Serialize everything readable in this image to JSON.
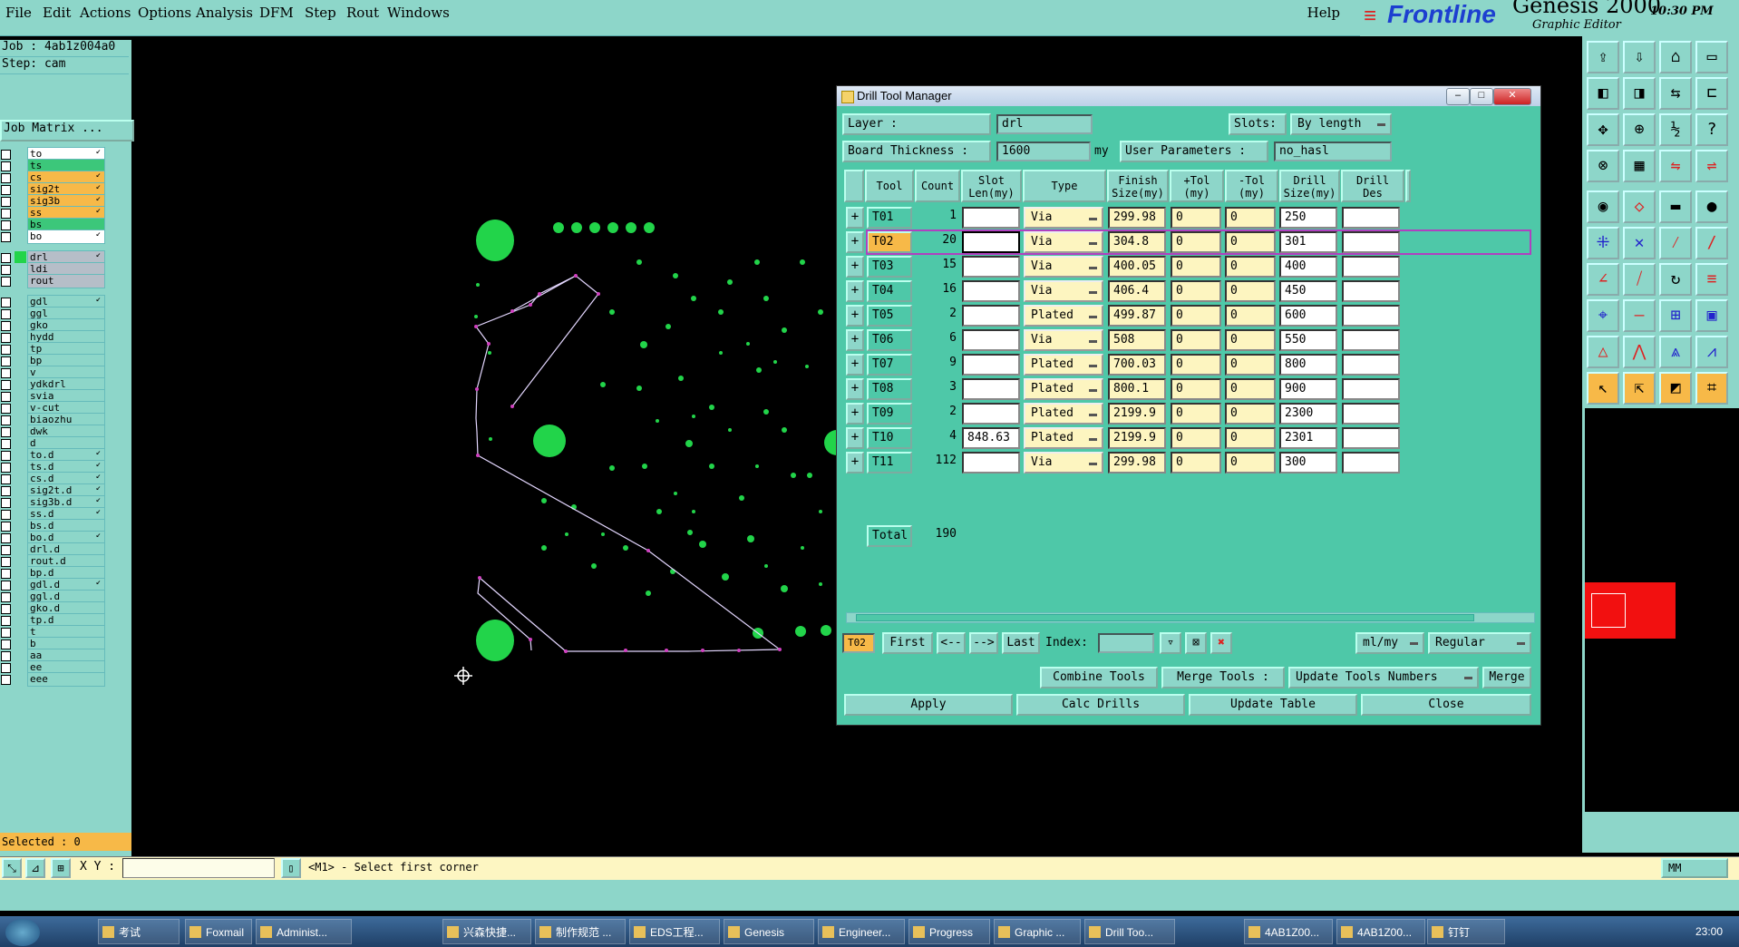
{
  "menubar": {
    "items": [
      "File",
      "Edit",
      "Actions",
      "Options",
      "Analysis",
      "DFM",
      "Step",
      "Rout",
      "Windows"
    ],
    "help": "Help",
    "brand": "Frontline",
    "product": "Genesis 2000",
    "subtitle": "Graphic Editor",
    "clock": "10:30 PM"
  },
  "left": {
    "job": "Job  : 4ab1z004a0",
    "step": "Step: cam",
    "job_matrix": "Job Matrix ...",
    "selected": "Selected : 0",
    "layers": [
      {
        "name": "to",
        "bg": "#ffffff",
        "ind": "",
        "arrow": true
      },
      {
        "name": "ts",
        "bg": "#3cc77a",
        "ind": "",
        "arrow": false
      },
      {
        "name": "cs",
        "bg": "#f7b948",
        "ind": "",
        "arrow": true
      },
      {
        "name": "sig2t",
        "bg": "#f7b948",
        "ind": "",
        "arrow": true
      },
      {
        "name": "sig3b",
        "bg": "#f7b948",
        "ind": "",
        "arrow": true
      },
      {
        "name": "ss",
        "bg": "#f7b948",
        "ind": "",
        "arrow": true
      },
      {
        "name": "bs",
        "bg": "#3cc77a",
        "ind": "",
        "arrow": false
      },
      {
        "name": "bo",
        "bg": "#ffffff",
        "ind": "",
        "arrow": true
      },
      {
        "name": "drl",
        "bg": "#b6bec8",
        "ind": "#22d44a",
        "arrow": true
      },
      {
        "name": "ldi",
        "bg": "#b6bec8",
        "ind": "",
        "arrow": false
      },
      {
        "name": "rout",
        "bg": "#b6bec8",
        "ind": "",
        "arrow": false
      },
      {
        "name": "gdl",
        "bg": "#8dd6c9",
        "ind": "",
        "arrow": true
      },
      {
        "name": "ggl",
        "bg": "#8dd6c9",
        "ind": "",
        "arrow": false
      },
      {
        "name": "gko",
        "bg": "#8dd6c9",
        "ind": "",
        "arrow": false
      },
      {
        "name": "hydd",
        "bg": "#8dd6c9",
        "ind": "",
        "arrow": false
      },
      {
        "name": "tp",
        "bg": "#8dd6c9",
        "ind": "",
        "arrow": false
      },
      {
        "name": "bp",
        "bg": "#8dd6c9",
        "ind": "",
        "arrow": false
      },
      {
        "name": "v",
        "bg": "#8dd6c9",
        "ind": "",
        "arrow": false
      },
      {
        "name": "ydkdrl",
        "bg": "#8dd6c9",
        "ind": "",
        "arrow": false
      },
      {
        "name": "svia",
        "bg": "#8dd6c9",
        "ind": "",
        "arrow": false
      },
      {
        "name": "v-cut",
        "bg": "#8dd6c9",
        "ind": "",
        "arrow": false
      },
      {
        "name": "biaozhu",
        "bg": "#8dd6c9",
        "ind": "",
        "arrow": false
      },
      {
        "name": "dwk",
        "bg": "#8dd6c9",
        "ind": "",
        "arrow": false
      },
      {
        "name": "d",
        "bg": "#8dd6c9",
        "ind": "",
        "arrow": false
      },
      {
        "name": "to.d",
        "bg": "#8dd6c9",
        "ind": "",
        "arrow": true
      },
      {
        "name": "ts.d",
        "bg": "#8dd6c9",
        "ind": "",
        "arrow": true
      },
      {
        "name": "cs.d",
        "bg": "#8dd6c9",
        "ind": "",
        "arrow": true
      },
      {
        "name": "sig2t.d",
        "bg": "#8dd6c9",
        "ind": "",
        "arrow": true
      },
      {
        "name": "sig3b.d",
        "bg": "#8dd6c9",
        "ind": "",
        "arrow": true
      },
      {
        "name": "ss.d",
        "bg": "#8dd6c9",
        "ind": "",
        "arrow": true
      },
      {
        "name": "bs.d",
        "bg": "#8dd6c9",
        "ind": "",
        "arrow": false
      },
      {
        "name": "bo.d",
        "bg": "#8dd6c9",
        "ind": "",
        "arrow": true
      },
      {
        "name": "drl.d",
        "bg": "#8dd6c9",
        "ind": "",
        "arrow": false
      },
      {
        "name": "rout.d",
        "bg": "#8dd6c9",
        "ind": "",
        "arrow": false
      },
      {
        "name": "bp.d",
        "bg": "#8dd6c9",
        "ind": "",
        "arrow": false
      },
      {
        "name": "gdl.d",
        "bg": "#8dd6c9",
        "ind": "",
        "arrow": true
      },
      {
        "name": "ggl.d",
        "bg": "#8dd6c9",
        "ind": "",
        "arrow": false
      },
      {
        "name": "gko.d",
        "bg": "#8dd6c9",
        "ind": "",
        "arrow": false
      },
      {
        "name": "tp.d",
        "bg": "#8dd6c9",
        "ind": "",
        "arrow": false
      },
      {
        "name": "t",
        "bg": "#8dd6c9",
        "ind": "",
        "arrow": false
      },
      {
        "name": "b",
        "bg": "#8dd6c9",
        "ind": "",
        "arrow": false
      },
      {
        "name": "aa",
        "bg": "#8dd6c9",
        "ind": "",
        "arrow": false
      },
      {
        "name": "ee",
        "bg": "#8dd6c9",
        "ind": "",
        "arrow": false
      },
      {
        "name": "eee",
        "bg": "#8dd6c9",
        "ind": "",
        "arrow": false
      }
    ]
  },
  "dialog": {
    "title": "Drill Tool Manager",
    "layer_label": "Layer          :",
    "layer_value": "drl",
    "slots_label": "Slots:",
    "slots_value": "By length",
    "thickness_label": "Board Thickness :",
    "thickness_value": "1600",
    "thickness_unit": "my",
    "userparams_label": "User Parameters :",
    "userparams_value": "no_hasl",
    "headers": {
      "tool": "Tool",
      "count": "Count",
      "slot": "Slot\nLen(my)",
      "type": "Type",
      "finish": "Finish\nSize(my)",
      "ptol": "+Tol\n(my)",
      "mtol": "-Tol\n(my)",
      "drill": "Drill\nSize(my)",
      "des": "Drill\nDes"
    },
    "rows": [
      {
        "tool": "T01",
        "count": "1",
        "slot": "",
        "type": "Via",
        "finish": "299.98",
        "ptol": "0",
        "mtol": "0",
        "drill": "250",
        "des": ""
      },
      {
        "tool": "T02",
        "count": "20",
        "slot": "",
        "type": "Via",
        "finish": "304.8",
        "ptol": "0",
        "mtol": "0",
        "drill": "301",
        "des": ""
      },
      {
        "tool": "T03",
        "count": "15",
        "slot": "",
        "type": "Via",
        "finish": "400.05",
        "ptol": "0",
        "mtol": "0",
        "drill": "400",
        "des": ""
      },
      {
        "tool": "T04",
        "count": "16",
        "slot": "",
        "type": "Via",
        "finish": "406.4",
        "ptol": "0",
        "mtol": "0",
        "drill": "450",
        "des": ""
      },
      {
        "tool": "T05",
        "count": "2",
        "slot": "",
        "type": "Plated",
        "finish": "499.87",
        "ptol": "0",
        "mtol": "0",
        "drill": "600",
        "des": ""
      },
      {
        "tool": "T06",
        "count": "6",
        "slot": "",
        "type": "Via",
        "finish": "508",
        "ptol": "0",
        "mtol": "0",
        "drill": "550",
        "des": ""
      },
      {
        "tool": "T07",
        "count": "9",
        "slot": "",
        "type": "Plated",
        "finish": "700.03",
        "ptol": "0",
        "mtol": "0",
        "drill": "800",
        "des": ""
      },
      {
        "tool": "T08",
        "count": "3",
        "slot": "",
        "type": "Plated",
        "finish": "800.1",
        "ptol": "0",
        "mtol": "0",
        "drill": "900",
        "des": ""
      },
      {
        "tool": "T09",
        "count": "2",
        "slot": "",
        "type": "Plated",
        "finish": "2199.9",
        "ptol": "0",
        "mtol": "0",
        "drill": "2300",
        "des": ""
      },
      {
        "tool": "T10",
        "count": "4",
        "slot": "848.63",
        "type": "Plated",
        "finish": "2199.9",
        "ptol": "0",
        "mtol": "0",
        "drill": "2301",
        "des": ""
      },
      {
        "tool": "T11",
        "count": "112",
        "slot": "",
        "type": "Via",
        "finish": "299.98",
        "ptol": "0",
        "mtol": "0",
        "drill": "300",
        "des": ""
      }
    ],
    "selected_row": 1,
    "total_label": "Total",
    "total_value": "190",
    "nav": {
      "current": "T02",
      "first": "First",
      "prev": "<--",
      "next": "-->",
      "last": "Last",
      "index_label": "Index:",
      "units": "ml/my",
      "mode": "Regular"
    },
    "actions": {
      "combine": "Combine Tools",
      "merge_tools": "Merge Tools :",
      "update_numbers": "Update Tools Numbers",
      "merge": "Merge",
      "apply": "Apply",
      "calc": "Calc Drills",
      "update_table": "Update Table",
      "close": "Close"
    }
  },
  "status": {
    "xy_label": "X Y :",
    "prompt": "<M1> - Select first corner",
    "units": "MM"
  },
  "taskbar": {
    "items": [
      "考试",
      "Foxmail",
      "Administ...",
      "兴森快捷...",
      "制作规范 ...",
      "EDS工程...",
      "Genesis",
      "Engineer...",
      "Progress",
      "Graphic ...",
      "Drill Too...",
      "4AB1Z00...",
      "4AB1Z00...",
      "钉钉"
    ],
    "time": "23:00"
  },
  "colors": {
    "accent": "#8dd6c9",
    "dialog": "#4ec8a8",
    "selected": "#f7b948",
    "feature": "#22d44a"
  }
}
